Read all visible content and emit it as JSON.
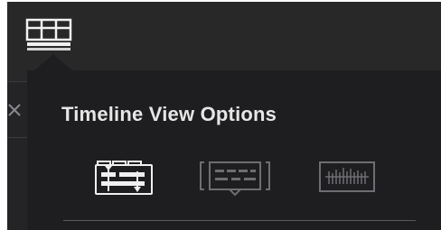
{
  "popover": {
    "title": "Timeline View Options"
  },
  "toolbar": {
    "timeline_view_icon": "timeline-view-icon"
  },
  "view_options": [
    {
      "icon": "stacked-timelines-icon",
      "active": true
    },
    {
      "icon": "subtitle-track-icon",
      "active": false
    },
    {
      "icon": "audio-waveform-icon",
      "active": false
    }
  ],
  "colors": {
    "background": "#242427",
    "popover": "#1e1e20",
    "title": "#e6e6e6",
    "icon_active": "#f0f0f0",
    "icon_inactive": "#6e6e72"
  }
}
